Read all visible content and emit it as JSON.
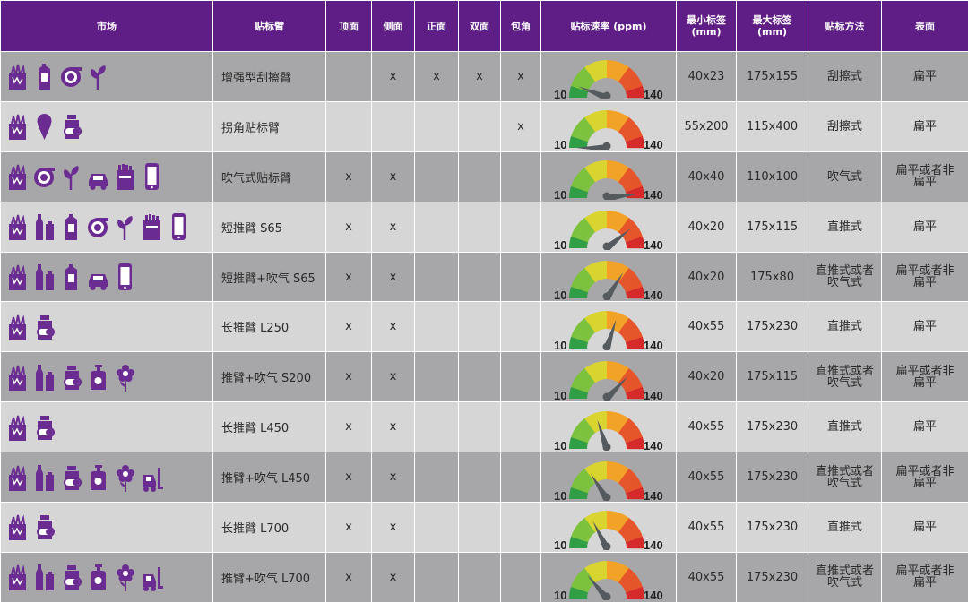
{
  "colors": {
    "header_bg": "#5f1d86",
    "row_dark": "#a7a7a9",
    "row_light": "#d6d6d7",
    "icon": "#6b2c91",
    "needle": "#555a5f"
  },
  "headers": {
    "market": "市场",
    "arm": "贴标臂",
    "top": "顶面",
    "side": "侧面",
    "front": "正面",
    "double": "双面",
    "wrap": "包角",
    "speed": "贴标速率 (ppm)",
    "min_label_1": "最小标签",
    "min_label_2": "(mm)",
    "max_label_1": "最大标签",
    "max_label_2": "(mm)",
    "method": "贴标方法",
    "surface": "表面"
  },
  "gauge": {
    "min": "10",
    "max": "140"
  },
  "rows": [
    {
      "icons": [
        "food-icon",
        "milk-carton-icon",
        "tape-roll-icon",
        "plant-icon"
      ],
      "arm": "增强型刮擦臂",
      "top": "",
      "side": "x",
      "front": "x",
      "double": "x",
      "wrap": "x",
      "speed_fraction": 0.12,
      "min": "40x23",
      "max": "175x155",
      "method": "刮擦式",
      "surface": [
        "扁平"
      ]
    },
    {
      "icons": [
        "food-icon",
        "ice-cream-icon",
        "pill-bottle-icon"
      ],
      "arm": "拐角贴标臂",
      "top": "",
      "side": "",
      "front": "",
      "double": "",
      "wrap": "x",
      "speed_fraction": 0.0,
      "min": "55x200",
      "max": "115x400",
      "method": "刮擦式",
      "surface": [
        "扁平"
      ]
    },
    {
      "icons": [
        "food-icon",
        "tape-roll-icon",
        "plant-icon",
        "car-icon",
        "cigarette-pack-icon",
        "smartphone-icon"
      ],
      "arm": "吹气式贴标臂",
      "top": "x",
      "side": "x",
      "front": "",
      "double": "",
      "wrap": "",
      "speed_fraction": 0.96,
      "min": "40x40",
      "max": "110x100",
      "method": "吹气式",
      "surface": [
        "扁平或者非",
        "扁平"
      ]
    },
    {
      "icons": [
        "food-icon",
        "bottles-icon",
        "milk-carton-icon",
        "tape-roll-icon",
        "plant-icon",
        "cigarette-pack-icon",
        "smartphone-icon"
      ],
      "arm": "短推臂 S65",
      "top": "x",
      "side": "x",
      "front": "",
      "double": "",
      "wrap": "",
      "speed_fraction": 0.78,
      "min": "40x20",
      "max": "175x115",
      "method": "直推式",
      "surface": [
        "扁平"
      ]
    },
    {
      "icons": [
        "food-icon",
        "bottles-icon",
        "milk-carton-icon",
        "car-icon",
        "smartphone-icon"
      ],
      "arm": "短推臂+吹气 S65",
      "top": "x",
      "side": "x",
      "front": "",
      "double": "",
      "wrap": "",
      "speed_fraction": 0.68,
      "min": "40x20",
      "max": "175x80",
      "method": [
        "直推式或者",
        "吹气式"
      ],
      "surface": [
        "扁平或者非",
        "扁平"
      ]
    },
    {
      "icons": [
        "food-icon",
        "pill-bottle-icon"
      ],
      "arm": "长推臂 L250",
      "top": "x",
      "side": "x",
      "front": "",
      "double": "",
      "wrap": "",
      "speed_fraction": 0.6,
      "min": "40x55",
      "max": "175x230",
      "method": "直推式",
      "surface": [
        "扁平"
      ]
    },
    {
      "icons": [
        "food-icon",
        "bottles-icon",
        "pill-bottle-icon",
        "soap-dispenser-icon",
        "flower-icon"
      ],
      "arm": "推臂+吹气 S200",
      "top": "x",
      "side": "x",
      "front": "",
      "double": "",
      "wrap": "",
      "speed_fraction": 0.74,
      "min": "40x20",
      "max": "175x115",
      "method": [
        "直推式或者",
        "吹气式"
      ],
      "surface": [
        "扁平或者非",
        "扁平"
      ]
    },
    {
      "icons": [
        "food-icon",
        "pill-bottle-icon"
      ],
      "arm": "长推臂 L450",
      "top": "x",
      "side": "x",
      "front": "",
      "double": "",
      "wrap": "",
      "speed_fraction": 0.4,
      "min": "40x55",
      "max": "175x230",
      "method": "直推式",
      "surface": [
        "扁平"
      ]
    },
    {
      "icons": [
        "food-icon",
        "bottles-icon",
        "pill-bottle-icon",
        "soap-dispenser-icon",
        "flower-icon",
        "forklift-icon"
      ],
      "arm": "推臂+吹气 L450",
      "top": "x",
      "side": "x",
      "front": "",
      "double": "",
      "wrap": "",
      "speed_fraction": 0.32,
      "min": "40x55",
      "max": "175x230",
      "method": [
        "直推式或者",
        "吹气式"
      ],
      "surface": [
        "扁平或者非",
        "扁平"
      ]
    },
    {
      "icons": [
        "food-icon",
        "pill-bottle-icon"
      ],
      "arm": "长推臂 L700",
      "top": "x",
      "side": "x",
      "front": "",
      "double": "",
      "wrap": "",
      "speed_fraction": 0.35,
      "min": "40x55",
      "max": "175x230",
      "method": "直推式",
      "surface": [
        "扁平"
      ]
    },
    {
      "icons": [
        "food-icon",
        "bottles-icon",
        "pill-bottle-icon",
        "soap-dispenser-icon",
        "flower-icon",
        "forklift-icon"
      ],
      "arm": "推臂+吹气 L700",
      "top": "x",
      "side": "x",
      "front": "",
      "double": "",
      "wrap": "",
      "speed_fraction": 0.28,
      "min": "40x55",
      "max": "175x230",
      "method": [
        "直推式或者",
        "吹气式"
      ],
      "surface": [
        "扁平或者非",
        "扁平"
      ]
    }
  ]
}
